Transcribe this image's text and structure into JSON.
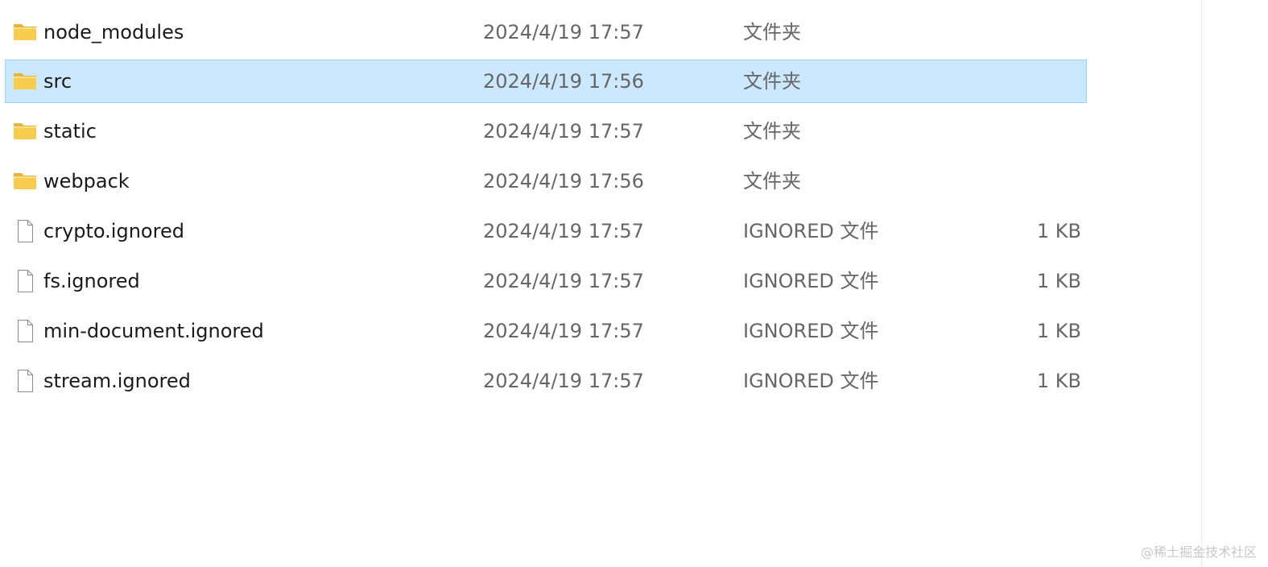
{
  "colors": {
    "selected_bg": "#cce8ff",
    "selected_border": "#99d1ff",
    "folder_yellow": "#f8cc4c",
    "folder_dark": "#e9b23a",
    "text_primary": "#1a1a1a",
    "text_secondary": "#666666"
  },
  "files": [
    {
      "icon": "folder-icon",
      "name": "node_modules",
      "date": "2024/4/19 17:57",
      "type": "文件夹",
      "size": "",
      "selected": false
    },
    {
      "icon": "folder-icon",
      "name": "src",
      "date": "2024/4/19 17:56",
      "type": "文件夹",
      "size": "",
      "selected": true
    },
    {
      "icon": "folder-icon",
      "name": "static",
      "date": "2024/4/19 17:57",
      "type": "文件夹",
      "size": "",
      "selected": false
    },
    {
      "icon": "folder-icon",
      "name": "webpack",
      "date": "2024/4/19 17:56",
      "type": "文件夹",
      "size": "",
      "selected": false
    },
    {
      "icon": "file-icon",
      "name": "crypto.ignored",
      "date": "2024/4/19 17:57",
      "type": "IGNORED 文件",
      "size": "1 KB",
      "selected": false
    },
    {
      "icon": "file-icon",
      "name": "fs.ignored",
      "date": "2024/4/19 17:57",
      "type": "IGNORED 文件",
      "size": "1 KB",
      "selected": false
    },
    {
      "icon": "file-icon",
      "name": "min-document.ignored",
      "date": "2024/4/19 17:57",
      "type": "IGNORED 文件",
      "size": "1 KB",
      "selected": false
    },
    {
      "icon": "file-icon",
      "name": "stream.ignored",
      "date": "2024/4/19 17:57",
      "type": "IGNORED 文件",
      "size": "1 KB",
      "selected": false
    }
  ],
  "watermark": "@稀土掘金技术社区"
}
